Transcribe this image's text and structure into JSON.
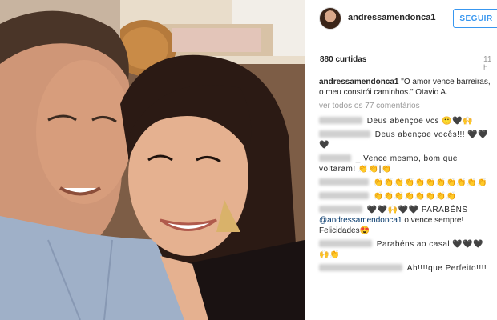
{
  "post": {
    "username": "andressamendonca1",
    "follow_label": "SEGUIR",
    "likes": "880 curtidas",
    "time": "11 h",
    "caption_user": "andressamendonca1",
    "caption_text": "\"O amor vence barreiras, o meu constrói caminhos.\" Otavio A.",
    "view_all": "ver todos os 77 comentários"
  },
  "comments": [
    {
      "text": "Deus abençoe vcs 🙂🖤🙌"
    },
    {
      "text": "Deus abençoe vocês!!! 🖤🖤🖤"
    },
    {
      "text": "_ Vence mesmo, bom que voltaram! 👏👏|👏"
    },
    {
      "text": "👏👏👏👏👏👏👏👏👏👏👏"
    },
    {
      "text": "👏👏👏👏👏👏👏👏"
    },
    {
      "text": "🖤🖤🙌🖤🖤 PARABÉNS",
      "mention": "@andressamendonca1",
      "after": " o vence sempre! Felicidades😍"
    },
    {
      "text": "Parabéns ao casal 🖤🖤🖤🙌👏"
    },
    {
      "text": "Ah!!!!que Perfeito!!!!"
    }
  ],
  "colors": {
    "accent": "#3897f0",
    "text": "#262626",
    "muted": "#999999",
    "mention": "#003569"
  }
}
